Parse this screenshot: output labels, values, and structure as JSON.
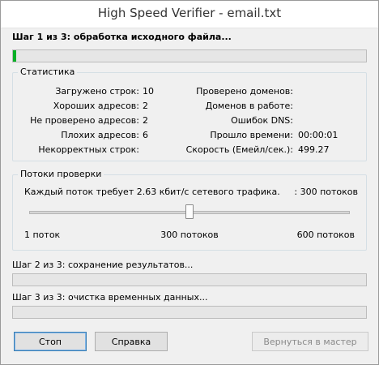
{
  "window": {
    "title": "High Speed Verifier - email.txt"
  },
  "step1": {
    "label": "Шаг 1 из 3: обработка исходного файла...",
    "progress_fraction": 0.01
  },
  "stats": {
    "title": "Статистика",
    "left": [
      {
        "label": "Загружено строк:",
        "value": "10"
      },
      {
        "label": "Хороших адресов:",
        "value": "2"
      },
      {
        "label": "Не проверено адресов:",
        "value": "2"
      },
      {
        "label": "Плохих адресов:",
        "value": "6"
      },
      {
        "label": "Некорректных строк:",
        "value": ""
      }
    ],
    "right": [
      {
        "label": "Проверено доменов:",
        "value": ""
      },
      {
        "label": "Доменов в работе:",
        "value": ""
      },
      {
        "label": "Ошибок DNS:",
        "value": ""
      },
      {
        "label": "Прошло времени:",
        "value": "00:00:01"
      },
      {
        "label": "Скорость (Емейл/сек.):",
        "value": "499.27"
      }
    ]
  },
  "threads": {
    "title": "Потоки проверки",
    "info": "Каждый поток требует 2.63 кбит/с сетевого трафика.",
    "current": ": 300 потоков",
    "min_label": "1 поток",
    "mid_label": "300 потоков",
    "max_label": "600 потоков",
    "slider_fraction": 0.5
  },
  "step2": {
    "label": "Шаг 2 из 3: сохранение результатов...",
    "progress_fraction": 0
  },
  "step3": {
    "label": "Шаг 3 из 3: очистка временных данных...",
    "progress_fraction": 0
  },
  "buttons": {
    "stop": "Стоп",
    "help": "Справка",
    "back": "Вернуться в мастер"
  }
}
